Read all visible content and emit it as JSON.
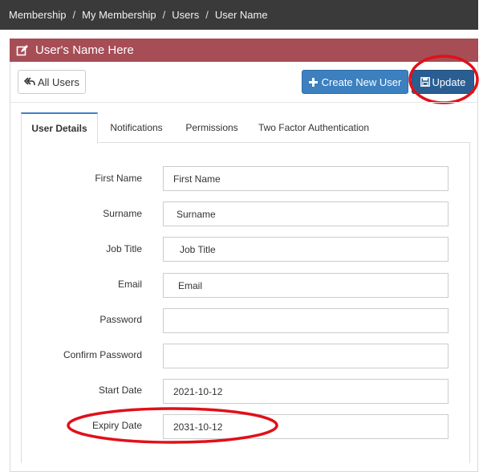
{
  "breadcrumb": {
    "items": [
      "Membership",
      "My Membership",
      "Users",
      "User Name"
    ],
    "separator": "/"
  },
  "panel": {
    "title": "User's Name Here",
    "header_color": "#a64d55"
  },
  "toolbar": {
    "all_users_label": "All Users",
    "create_label": "Create New User",
    "update_label": "Update"
  },
  "tabs": [
    "User Details",
    "Notifications",
    "Permissions",
    "Two Factor Authentication"
  ],
  "form": {
    "first_name": {
      "label": "First Name",
      "value": "First Name"
    },
    "surname": {
      "label": "Surname",
      "value": "Surname"
    },
    "job_title": {
      "label": "Job Title",
      "value": "Job Title"
    },
    "email": {
      "label": "Email",
      "value": "Email"
    },
    "password": {
      "label": "Password",
      "value": ""
    },
    "confirm_password": {
      "label": "Confirm Password",
      "value": ""
    },
    "start_date": {
      "label": "Start Date",
      "value": "2021-10-12"
    },
    "expiry_date": {
      "label": "Expiry Date",
      "value": "2031-10-12"
    }
  },
  "colors": {
    "primary": "#3c80c0",
    "update": "#2a5e93",
    "annotation": "#e0101a"
  }
}
